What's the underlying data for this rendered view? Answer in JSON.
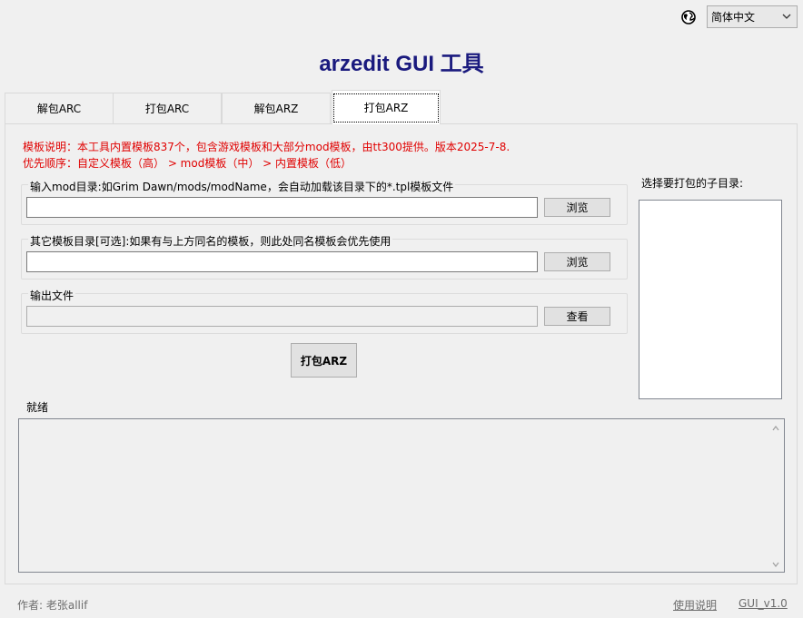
{
  "language": {
    "selected": "简体中文",
    "icon": "globe-icon"
  },
  "app_title": "arzedit GUI 工具",
  "tabs": [
    {
      "label": "解包ARC",
      "active": false
    },
    {
      "label": "打包ARC",
      "active": false
    },
    {
      "label": "解包ARZ",
      "active": false
    },
    {
      "label": "打包ARZ",
      "active": true
    }
  ],
  "notes": {
    "line1": "模板说明：本工具内置模板837个，包含游戏模板和大部分mod模板，由tt300提供。版本2025-7-8.",
    "line2": "优先顺序：自定义模板（高） > mod模板（中） > 内置模板（低）"
  },
  "input_group": {
    "label": "输入mod目录:如Grim Dawn/mods/modName，会自动加载该目录下的*.tpl模板文件",
    "value": "",
    "button": "浏览"
  },
  "template_group": {
    "label": "其它模板目录[可选]:如果有与上方同名的模板，则此处同名模板会优先使用",
    "value": "",
    "button": "浏览"
  },
  "output_group": {
    "label": "输出文件",
    "value": "",
    "button": "查看"
  },
  "pack_button": "打包ARZ",
  "subdir": {
    "label": "选择要打包的子目录:"
  },
  "status": "就绪",
  "footer": {
    "author": "作者: 老张allif",
    "help_link": "使用说明",
    "version_link": "GUI_v1.0"
  },
  "colors": {
    "title": "#1a1a7e",
    "note": "#e00000"
  }
}
